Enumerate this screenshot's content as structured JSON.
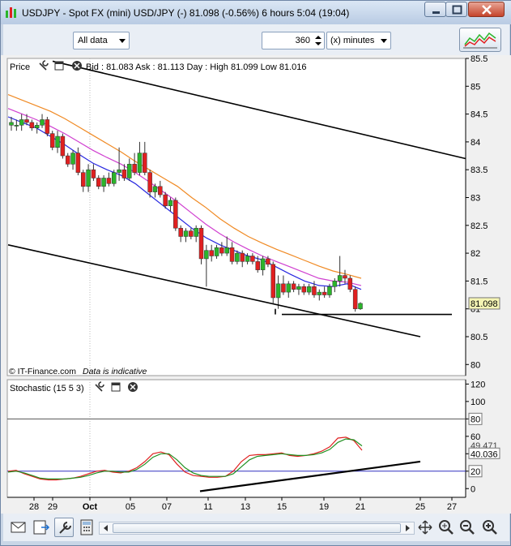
{
  "window": {
    "title": "USDJPY - Spot FX (mini) USD/JPY (-)    81.098 (-0.56%)    6 hours  5:04 (19:04)"
  },
  "toolbar": {
    "data_range": "All data",
    "interval_value": "360",
    "interval_unit": "(x) minutes"
  },
  "price_panel": {
    "label": "Price",
    "quote": "Bid : 81.083  Ask : 81.113  Day : High 81.099  Low 81.016",
    "footer_brand": "© IT-Finance.com",
    "footer_note": "Data is indicative",
    "current_price": "81.098"
  },
  "stochastic_panel": {
    "label": "Stochastic (15 5 3)",
    "k_value": "49.471",
    "d_value": "40.036"
  },
  "colors": {
    "bull_candle": "#2bb52b",
    "bear_candle": "#e02020",
    "ma_orange": "#f08a24",
    "ma_magenta": "#d040d0",
    "ma_blue": "#2828e0",
    "stoch_k": "#e02020",
    "stoch_d": "#209020",
    "current_price_box": "#f5f5b4",
    "background": "#ffffff"
  },
  "chart_data": [
    {
      "type": "candlestick",
      "title": "USDJPY",
      "x_tick_labels": [
        "28",
        "29",
        "Oct",
        "05",
        "07",
        "11",
        "13",
        "15",
        "19",
        "21",
        "25",
        "27"
      ],
      "y_tick_labels": [
        "85.5",
        "85",
        "84.5",
        "84",
        "83.5",
        "83",
        "82.5",
        "82",
        "81.5",
        "81",
        "80.5",
        "80"
      ],
      "ylim": [
        79.8,
        85.5
      ],
      "grid": false,
      "ohlc": [
        [
          84.3,
          84.45,
          84.2,
          84.35
        ],
        [
          84.3,
          84.4,
          84.2,
          84.3
        ],
        [
          84.3,
          84.5,
          84.2,
          84.4
        ],
        [
          84.4,
          84.5,
          84.3,
          84.35
        ],
        [
          84.35,
          84.4,
          84.2,
          84.25
        ],
        [
          84.25,
          84.35,
          84.15,
          84.3
        ],
        [
          84.3,
          84.5,
          84.25,
          84.4
        ],
        [
          84.4,
          84.45,
          84.1,
          84.15
        ],
        [
          84.15,
          84.2,
          83.85,
          83.9
        ],
        [
          83.9,
          84.2,
          83.8,
          84.1
        ],
        [
          84.1,
          84.15,
          83.7,
          83.75
        ],
        [
          83.75,
          83.8,
          83.55,
          83.6
        ],
        [
          83.6,
          83.85,
          83.5,
          83.8
        ],
        [
          83.8,
          83.9,
          83.4,
          83.45
        ],
        [
          83.45,
          83.5,
          83.1,
          83.2
        ],
        [
          83.2,
          83.6,
          83.1,
          83.5
        ],
        [
          83.5,
          83.6,
          83.3,
          83.35
        ],
        [
          83.35,
          83.4,
          83.15,
          83.2
        ],
        [
          83.2,
          83.4,
          83.1,
          83.35
        ],
        [
          83.35,
          83.45,
          83.2,
          83.25
        ],
        [
          83.25,
          83.5,
          83.2,
          83.45
        ],
        [
          83.45,
          83.9,
          83.3,
          83.5
        ],
        [
          83.5,
          83.6,
          83.3,
          83.35
        ],
        [
          83.35,
          83.7,
          83.3,
          83.6
        ],
        [
          83.6,
          83.8,
          83.4,
          83.45
        ],
        [
          83.45,
          84.0,
          83.4,
          83.8
        ],
        [
          83.8,
          84.0,
          83.4,
          83.45
        ],
        [
          83.45,
          83.5,
          83.0,
          83.1
        ],
        [
          83.1,
          83.25,
          83.0,
          83.2
        ],
        [
          83.2,
          83.3,
          83.0,
          83.05
        ],
        [
          83.05,
          83.1,
          82.8,
          82.85
        ],
        [
          82.85,
          83.0,
          82.75,
          82.95
        ],
        [
          82.95,
          83.0,
          82.4,
          82.45
        ],
        [
          82.45,
          82.5,
          82.2,
          82.3
        ],
        [
          82.3,
          82.45,
          82.2,
          82.4
        ],
        [
          82.4,
          82.45,
          82.25,
          82.3
        ],
        [
          82.3,
          82.5,
          82.2,
          82.45
        ],
        [
          82.45,
          82.5,
          81.8,
          81.9
        ],
        [
          81.9,
          82.15,
          81.4,
          82.05
        ],
        [
          82.05,
          82.15,
          81.85,
          81.95
        ],
        [
          81.95,
          82.15,
          81.9,
          82.1
        ],
        [
          82.1,
          82.2,
          81.95,
          82.0
        ],
        [
          82.0,
          82.3,
          81.95,
          82.1
        ],
        [
          82.1,
          82.2,
          81.8,
          81.85
        ],
        [
          81.85,
          82.05,
          81.8,
          82.0
        ],
        [
          82.0,
          82.05,
          81.75,
          81.85
        ],
        [
          81.85,
          82.0,
          81.8,
          81.95
        ],
        [
          81.95,
          82.0,
          81.8,
          81.85
        ],
        [
          81.85,
          81.95,
          81.65,
          81.7
        ],
        [
          81.7,
          81.95,
          81.6,
          81.9
        ],
        [
          81.9,
          81.95,
          81.75,
          81.8
        ],
        [
          81.8,
          81.85,
          81.1,
          81.2
        ],
        [
          81.2,
          81.6,
          81.0,
          81.45
        ],
        [
          81.45,
          81.6,
          81.25,
          81.3
        ],
        [
          81.3,
          81.5,
          81.2,
          81.45
        ],
        [
          81.45,
          81.5,
          81.3,
          81.35
        ],
        [
          81.35,
          81.45,
          81.25,
          81.4
        ],
        [
          81.4,
          81.45,
          81.25,
          81.3
        ],
        [
          81.3,
          81.45,
          81.25,
          81.4
        ],
        [
          81.4,
          81.5,
          81.2,
          81.25
        ],
        [
          81.25,
          81.35,
          81.15,
          81.3
        ],
        [
          81.3,
          81.4,
          81.2,
          81.25
        ],
        [
          81.25,
          81.45,
          81.2,
          81.4
        ],
        [
          81.4,
          81.55,
          81.3,
          81.5
        ],
        [
          81.5,
          81.95,
          81.4,
          81.6
        ],
        [
          81.6,
          81.7,
          81.45,
          81.55
        ],
        [
          81.55,
          81.6,
          81.3,
          81.35
        ],
        [
          81.35,
          81.4,
          80.95,
          81.0
        ],
        [
          81.0,
          81.12,
          80.98,
          81.098
        ]
      ],
      "moving_averages": [
        {
          "values": [
            84.85,
            84.75,
            84.65,
            84.55,
            84.42,
            84.27,
            84.12,
            83.97,
            83.82,
            83.65,
            83.5,
            83.35,
            83.2,
            83.0,
            82.82,
            82.62,
            82.45,
            82.3,
            82.18,
            82.07,
            81.97,
            81.87,
            81.77,
            81.68,
            81.62,
            81.55
          ]
        },
        {
          "values": [
            84.6,
            84.5,
            84.4,
            84.28,
            84.15,
            84.0,
            83.85,
            83.72,
            83.6,
            83.45,
            83.28,
            83.1,
            82.92,
            82.72,
            82.52,
            82.35,
            82.2,
            82.07,
            81.95,
            81.85,
            81.75,
            81.65,
            81.55,
            81.5,
            81.48,
            81.42
          ]
        },
        {
          "values": [
            84.45,
            84.35,
            84.25,
            84.1,
            83.95,
            83.78,
            83.62,
            83.5,
            83.4,
            83.25,
            83.05,
            82.85,
            82.65,
            82.45,
            82.28,
            82.15,
            82.05,
            81.95,
            81.88,
            81.75,
            81.62,
            81.5,
            81.42,
            81.4,
            81.45,
            81.35
          ]
        }
      ],
      "trendlines": [
        {
          "from": [
            "29",
            85.45
          ],
          "to": [
            "27+",
            83.7
          ]
        },
        {
          "from": [
            "28-",
            82.15
          ],
          "to": [
            "25",
            80.5
          ]
        },
        {
          "from": [
            "15",
            80.9
          ],
          "to": [
            "27",
            80.9
          ]
        }
      ]
    },
    {
      "type": "line",
      "title": "Stochastic (15 5 3)",
      "y_tick_labels": [
        "120",
        "100",
        "80",
        "60",
        "40",
        "20",
        "0"
      ],
      "ylim": [
        -10,
        125
      ],
      "reference_lines": [
        80,
        20
      ],
      "series": [
        {
          "values": [
            20,
            21,
            17,
            14,
            11,
            10,
            10,
            11,
            12,
            14,
            17,
            20,
            21,
            19,
            18,
            20,
            24,
            31,
            40,
            42,
            39,
            28,
            19,
            15,
            14,
            13,
            13,
            14,
            20,
            31,
            38,
            39,
            39,
            40,
            41,
            38,
            37,
            38,
            40,
            43,
            48,
            58,
            59,
            55,
            44
          ]
        },
        {
          "values": [
            19,
            20,
            18,
            15,
            12,
            11,
            11,
            11,
            12,
            13,
            15,
            18,
            20,
            20,
            19,
            19,
            22,
            28,
            36,
            40,
            40,
            33,
            24,
            18,
            15,
            14,
            14,
            14,
            17,
            25,
            33,
            37,
            38,
            39,
            40,
            39,
            38,
            38,
            39,
            41,
            45,
            53,
            57,
            56,
            49
          ]
        }
      ],
      "trendlines": [
        {
          "from": [
            "11-",
            -3
          ],
          "to": [
            "25",
            31
          ]
        }
      ]
    }
  ]
}
